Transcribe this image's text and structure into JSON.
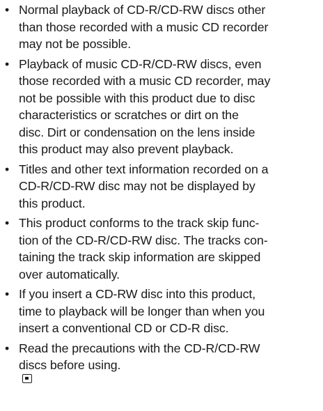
{
  "bullets": [
    {
      "lines": [
        "Normal playback of CD-R/CD-RW discs other",
        "than those recorded with a music CD recorder",
        "may not be possible."
      ]
    },
    {
      "lines": [
        "Playback of music CD-R/CD-RW discs, even",
        "those recorded with a music CD recorder, may",
        "not be possible with this product due to disc",
        "characteristics or scratches or dirt on the",
        "disc. Dirt or condensation on the lens inside",
        "this product may also prevent playback."
      ]
    },
    {
      "lines": [
        "Titles and other text information recorded on a",
        "CD-R/CD-RW disc may not be displayed by",
        "this product."
      ]
    },
    {
      "lines": [
        "This product conforms to the track skip func-",
        "tion of the CD-R/CD-RW disc. The tracks con-",
        "taining the track skip information are skipped",
        "over automatically."
      ]
    },
    {
      "lines": [
        "If you insert a CD-RW disc into this product,",
        "time to playback will be longer than when you",
        "insert a conventional CD or CD-R disc."
      ]
    },
    {
      "lines": [
        "Read the precautions with the CD-R/CD-RW",
        "discs before using."
      ]
    }
  ],
  "bullet_symbol": "•",
  "end_mark_icon": "end-of-section-icon"
}
